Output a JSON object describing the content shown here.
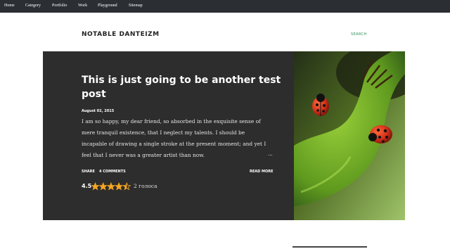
{
  "nav": {
    "items": [
      {
        "label": "Home"
      },
      {
        "label": "Category"
      },
      {
        "label": "Portfolio"
      },
      {
        "label": "Work"
      },
      {
        "label": "Playground"
      },
      {
        "label": "Sitemap"
      }
    ]
  },
  "header": {
    "blog_title": "NOTABLE DANTEIZM",
    "search_label": "SEARCH"
  },
  "post": {
    "title": "This is just going to be another test post",
    "date": "August 02, 2015",
    "snippet": "I am so happy, my dear friend, so absorbed in the exquisite sense of mere tranquil existence, that I neglect my talents. I should be incapable of drawing a single stroke at the present moment; and yet I feel that I never was a greater artist than now.",
    "ellipsis": "...",
    "share_label": "SHARE",
    "comments_label": "4 COMMENTS",
    "read_more_label": "READ MORE",
    "rating": {
      "value_text": "4.5",
      "value": 4.5,
      "max": 5,
      "votes_text": "2 голоса",
      "star_color": "#f5a623"
    },
    "image_icon": "ladybugs-on-plant-stem-photo"
  },
  "colors": {
    "nav_bg": "#2b2f33",
    "card_bg": "#2d2d2d",
    "accent": "#2e8b57"
  }
}
